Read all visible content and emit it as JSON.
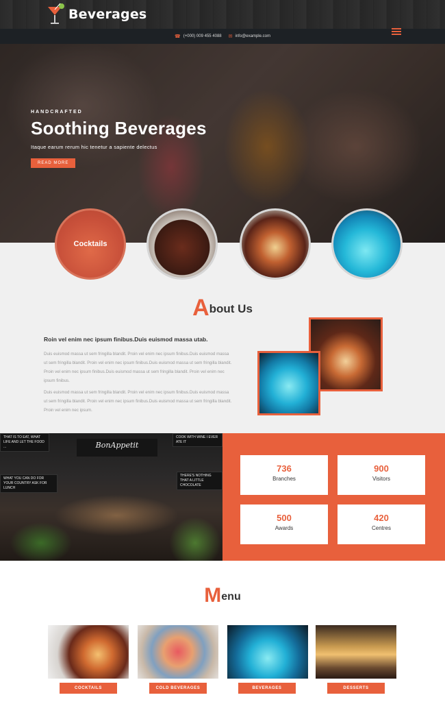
{
  "brand": {
    "name": "Beverages",
    "accent": "#e8603c",
    "dark": "#1d2125"
  },
  "contact": {
    "phone": "(+000) 009 455 4088",
    "email": "info@example.com"
  },
  "icons": {
    "phone": "phone-icon",
    "email": "envelope-icon",
    "menu": "hamburger-menu-icon",
    "logo": "cocktail-glass-icon"
  },
  "hero": {
    "kicker": "HANDCRAFTED",
    "title": "Soothing Beverages",
    "subtitle": "Itaque earum rerum hic tenetur a sapiente delectus",
    "button": "READ MORE"
  },
  "circles": [
    {
      "label": "Cocktails"
    }
  ],
  "about": {
    "title_initial": "A",
    "title_rest": "bout Us",
    "lead": "Roin vel enim nec ipsum finibus.Duis euismod massa utab.",
    "paragraphs": [
      "Duis euismod massa ut sem fringilla blandit. Proin vel enim nec ipsum finibus.Duis euismod massa ut sem fringilla blandit. Proin vel enim nec ipsum finibus.Duis euismod massa ut sem fringilla blandit. Proin vel enim nec ipsum finibus.Duis euismod massa ut sem fringilla blandit. Proin vel enim nec ipsum finibus.",
      "Duis euismod massa ut sem fringilla blandit. Proin vel enim nec ipsum finibus.Duis euismod massa ut sem fringilla blandit. Proin vel enim nec ipsum finibus.Duis euismod massa ut sem fringilla blandit. Proin vel enim nec ipsum."
    ]
  },
  "restaurant_signs": {
    "title": "BonAppetit",
    "board_left_top": "THAT IS TO EAT, WHAT LIFE AND LET THE FOOD ...",
    "board_left_bottom": "WHAT YOU CAN DO FOR YOUR COUNTRY ASK FOR LUNCH",
    "board_right_top": "COOK WITH WINE I EVER ATE IT",
    "board_right_bottom": "THERE'S NOTHING THAT A LITTLE CHOCOLATE"
  },
  "stats": [
    {
      "value": "736",
      "label": "Branches"
    },
    {
      "value": "900",
      "label": "Visitors"
    },
    {
      "value": "500",
      "label": "Awards"
    },
    {
      "value": "420",
      "label": "Centres"
    }
  ],
  "menu": {
    "title_initial": "M",
    "title_rest": "enu",
    "items": [
      {
        "label": "COCKTAILS"
      },
      {
        "label": "COLD BEVERAGES"
      },
      {
        "label": "BEVERAGES"
      },
      {
        "label": "DESSERTS"
      }
    ]
  }
}
